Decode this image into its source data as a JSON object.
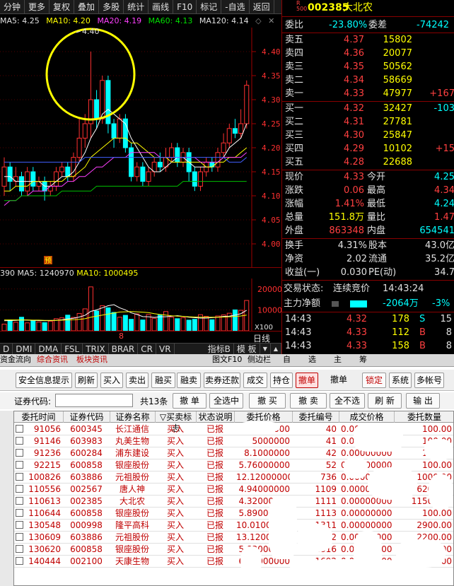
{
  "toolbar": {
    "items": [
      "分钟",
      "更多",
      "复权",
      "叠加",
      "多股",
      "统计",
      "画线",
      "F10",
      "标记",
      "-自选",
      "返回"
    ]
  },
  "ma_line": {
    "ma5": "MA5: 4.25",
    "ma10": "MA10: 4.20",
    "ma20": "MA20: 4.19",
    "ma60": "MA60: 4.13",
    "ma120": "MA120: 4.14"
  },
  "chart_data": [
    {
      "type": "candlestick",
      "ylim": [
        3.95,
        4.45
      ],
      "yticks": [
        "4.40",
        "4.35",
        "4.30",
        "4.25",
        "4.20",
        "4.15",
        "4.10",
        "4.05",
        "4.00"
      ],
      "annotation": "4.40",
      "marker": "预",
      "candles": [
        {
          "o": 4.12,
          "c": 4.16,
          "h": 4.18,
          "l": 4.1
        },
        {
          "o": 4.16,
          "c": 4.13,
          "h": 4.17,
          "l": 4.11
        },
        {
          "o": 4.13,
          "c": 4.14,
          "h": 4.16,
          "l": 4.12
        },
        {
          "o": 4.14,
          "c": 4.11,
          "h": 4.15,
          "l": 4.1
        },
        {
          "o": 4.11,
          "c": 4.15,
          "h": 4.16,
          "l": 4.1
        },
        {
          "o": 4.15,
          "c": 4.12,
          "h": 4.16,
          "l": 4.11
        },
        {
          "o": 4.12,
          "c": 4.13,
          "h": 4.14,
          "l": 4.11
        },
        {
          "o": 4.13,
          "c": 4.11,
          "h": 4.14,
          "l": 4.09
        },
        {
          "o": 4.11,
          "c": 4.12,
          "h": 4.13,
          "l": 4.1
        },
        {
          "o": 4.12,
          "c": 4.15,
          "h": 4.16,
          "l": 4.11
        },
        {
          "o": 4.15,
          "c": 4.16,
          "h": 4.17,
          "l": 4.14
        },
        {
          "o": 4.16,
          "c": 4.14,
          "h": 4.17,
          "l": 4.13
        },
        {
          "o": 4.14,
          "c": 4.18,
          "h": 4.19,
          "l": 4.13
        },
        {
          "o": 4.18,
          "c": 4.22,
          "h": 4.26,
          "l": 4.17
        },
        {
          "o": 4.22,
          "c": 4.25,
          "h": 4.27,
          "l": 4.2
        },
        {
          "o": 4.25,
          "c": 4.3,
          "h": 4.4,
          "l": 4.22
        },
        {
          "o": 4.3,
          "c": 4.26,
          "h": 4.32,
          "l": 4.24
        },
        {
          "o": 4.26,
          "c": 4.34,
          "h": 4.35,
          "l": 4.25
        },
        {
          "o": 4.34,
          "c": 4.25,
          "h": 4.35,
          "l": 4.23
        },
        {
          "o": 4.25,
          "c": 4.22,
          "h": 4.26,
          "l": 4.2
        },
        {
          "o": 4.22,
          "c": 4.26,
          "h": 4.27,
          "l": 4.21
        },
        {
          "o": 4.26,
          "c": 4.2,
          "h": 4.27,
          "l": 4.19
        },
        {
          "o": 4.2,
          "c": 4.14,
          "h": 4.21,
          "l": 4.13
        },
        {
          "o": 4.14,
          "c": 4.16,
          "h": 4.17,
          "l": 4.13
        },
        {
          "o": 4.16,
          "c": 4.13,
          "h": 4.17,
          "l": 4.12
        },
        {
          "o": 4.13,
          "c": 4.15,
          "h": 4.16,
          "l": 4.12
        },
        {
          "o": 4.15,
          "c": 4.17,
          "h": 4.18,
          "l": 4.14
        },
        {
          "o": 4.17,
          "c": 4.16,
          "h": 4.19,
          "l": 4.15
        },
        {
          "o": 4.16,
          "c": 4.18,
          "h": 4.2,
          "l": 4.15
        },
        {
          "o": 4.18,
          "c": 4.2,
          "h": 4.21,
          "l": 4.17
        },
        {
          "o": 4.2,
          "c": 4.17,
          "h": 4.21,
          "l": 4.16
        },
        {
          "o": 4.17,
          "c": 4.19,
          "h": 4.2,
          "l": 4.16
        },
        {
          "o": 4.19,
          "c": 4.15,
          "h": 4.2,
          "l": 4.13
        },
        {
          "o": 4.15,
          "c": 4.12,
          "h": 4.16,
          "l": 4.11
        },
        {
          "o": 4.12,
          "c": 4.15,
          "h": 4.16,
          "l": 4.11
        },
        {
          "o": 4.15,
          "c": 4.17,
          "h": 4.18,
          "l": 4.14
        },
        {
          "o": 4.17,
          "c": 4.16,
          "h": 4.18,
          "l": 4.15
        },
        {
          "o": 4.16,
          "c": 4.19,
          "h": 4.2,
          "l": 4.15
        },
        {
          "o": 4.19,
          "c": 4.21,
          "h": 4.23,
          "l": 4.18
        },
        {
          "o": 4.21,
          "c": 4.24,
          "h": 4.25,
          "l": 4.2
        },
        {
          "o": 4.24,
          "c": 4.23,
          "h": 4.26,
          "l": 4.22
        },
        {
          "o": 4.23,
          "c": 4.25,
          "h": 4.28,
          "l": 4.22
        },
        {
          "o": 4.25,
          "c": 4.33,
          "h": 4.34,
          "l": 4.24
        }
      ],
      "series": [
        {
          "values": [
            4.14,
            4.14,
            4.13,
            4.13,
            4.13,
            4.13,
            4.13,
            4.12,
            4.12,
            4.13,
            4.14,
            4.14,
            4.15,
            4.17,
            4.19,
            4.22,
            4.24,
            4.27,
            4.28,
            4.27,
            4.26,
            4.25,
            4.22,
            4.2,
            4.18,
            4.16,
            4.15,
            4.15,
            4.16,
            4.17,
            4.18,
            4.18,
            4.17,
            4.16,
            4.16,
            4.16,
            4.16,
            4.17,
            4.18,
            4.2,
            4.21,
            4.22,
            4.25
          ]
        },
        {
          "values": [
            4.11,
            4.11,
            4.12,
            4.12,
            4.12,
            4.13,
            4.13,
            4.13,
            4.13,
            4.13,
            4.13,
            4.14,
            4.14,
            4.15,
            4.16,
            4.18,
            4.19,
            4.2,
            4.21,
            4.22,
            4.22,
            4.22,
            4.21,
            4.21,
            4.2,
            4.19,
            4.18,
            4.18,
            4.18,
            4.17,
            4.17,
            4.17,
            4.17,
            4.17,
            4.17,
            4.16,
            4.16,
            4.17,
            4.17,
            4.18,
            4.18,
            4.19,
            4.2
          ]
        },
        {
          "values": [
            4.08,
            4.09,
            4.09,
            4.1,
            4.1,
            4.11,
            4.11,
            4.11,
            4.12,
            4.12,
            4.12,
            4.13,
            4.13,
            4.14,
            4.14,
            4.15,
            4.16,
            4.16,
            4.17,
            4.18,
            4.18,
            4.18,
            4.19,
            4.19,
            4.19,
            4.19,
            4.19,
            4.18,
            4.18,
            4.18,
            4.18,
            4.18,
            4.18,
            4.18,
            4.17,
            4.17,
            4.17,
            4.17,
            4.18,
            4.18,
            4.18,
            4.18,
            4.19
          ]
        },
        {
          "values": [
            4.09,
            4.09,
            4.09,
            4.1,
            4.1,
            4.1,
            4.1,
            4.1,
            4.1,
            4.1,
            4.11,
            4.11,
            4.11,
            4.11,
            4.11,
            4.11,
            4.12,
            4.12,
            4.12,
            4.12,
            4.12,
            4.12,
            4.12,
            4.12,
            4.12,
            4.12,
            4.12,
            4.12,
            4.12,
            4.12,
            4.12,
            4.13,
            4.13,
            4.13,
            4.13,
            4.13,
            4.13,
            4.13,
            4.13,
            4.13,
            4.13,
            4.13,
            4.13
          ]
        },
        {
          "values": [
            4.17,
            4.17,
            4.17,
            4.17,
            4.17,
            4.17,
            4.17,
            4.17,
            4.17,
            4.17,
            4.17,
            4.17,
            4.17,
            4.17,
            4.18,
            4.18,
            4.18,
            4.18,
            4.18,
            4.18,
            4.18,
            4.18,
            4.18,
            4.18,
            4.18,
            4.18,
            4.18,
            4.18,
            4.18,
            4.18,
            4.18,
            4.18,
            4.18,
            4.18,
            4.18,
            4.18,
            4.18,
            4.18,
            4.18,
            4.17,
            4.17,
            4.17,
            4.18
          ]
        }
      ]
    },
    {
      "type": "bar",
      "ylim": [
        0,
        25000
      ],
      "yticks": [
        "20000",
        "10000"
      ],
      "unit": "X100",
      "values": [
        3200,
        5200,
        4100,
        6500,
        3800,
        5000,
        4200,
        3900,
        4600,
        5800,
        6200,
        7500,
        6400,
        8300,
        10500,
        21000,
        9500,
        12000,
        11000,
        8800,
        6500,
        7400,
        5500,
        8100,
        5200,
        7800,
        6000,
        7500,
        9200,
        6500,
        5800,
        6300,
        5100,
        5500,
        7700,
        6900,
        5300,
        7100,
        7600,
        8400,
        10000,
        9800,
        14500
      ],
      "ma1": [
        4800,
        4900,
        5000,
        5200,
        5100,
        5000,
        4900,
        4800,
        4900,
        5000,
        5300,
        5700,
        6000,
        6600,
        7400,
        9300,
        10000,
        11000,
        12000,
        12500,
        11000,
        10000,
        8600,
        7800,
        6800,
        6700,
        6400,
        6700,
        6700,
        7000,
        7200,
        6900,
        6500,
        6300,
        6100,
        6100,
        6300,
        6500,
        6900,
        7000,
        7500,
        8200,
        9800
      ],
      "ma2": [
        5200,
        5200,
        5200,
        5200,
        5200,
        5100,
        5100,
        5000,
        5000,
        5000,
        5100,
        5200,
        5300,
        5500,
        5800,
        6500,
        7000,
        7500,
        8000,
        8500,
        9000,
        9100,
        9200,
        9100,
        8900,
        8700,
        8200,
        7800,
        7500,
        7200,
        7000,
        6900,
        6700,
        6600,
        6500,
        6500,
        6500,
        6500,
        6600,
        6700,
        6900,
        7100,
        7500
      ]
    }
  ],
  "vol_line": {
    "prefix": "390",
    "ma5": "MA5: 1240970",
    "ma10": "MA10: 1000495"
  },
  "date_label": "日线",
  "marker_label": "预",
  "circle_label": "4.40",
  "x_marker": "8",
  "indicator_tabs": [
    "D",
    "DMI",
    "DMA",
    "FSL",
    "TRIX",
    "BRAR",
    "CR",
    "VR"
  ],
  "indicator_buttons": [
    "指标B",
    "模 板"
  ],
  "quote": {
    "code_prefix": "R\n500",
    "code": "002385",
    "name": "大北农",
    "weibi_label": "委比",
    "weibi": "-23.80%",
    "weicha_label": "委差",
    "weicha": "-74242",
    "asks": [
      {
        "label": "卖五",
        "price": "4.37",
        "vol": "15802",
        "chg": ""
      },
      {
        "label": "卖四",
        "price": "4.36",
        "vol": "20077",
        "chg": ""
      },
      {
        "label": "卖三",
        "price": "4.35",
        "vol": "50562",
        "chg": ""
      },
      {
        "label": "卖二",
        "price": "4.34",
        "vol": "58669",
        "chg": ""
      },
      {
        "label": "卖一",
        "price": "4.33",
        "vol": "47977",
        "chg": "+167"
      }
    ],
    "bids": [
      {
        "label": "买一",
        "price": "4.32",
        "vol": "32427",
        "chg": "-103"
      },
      {
        "label": "买二",
        "price": "4.31",
        "vol": "27781",
        "chg": ""
      },
      {
        "label": "买三",
        "price": "4.30",
        "vol": "25847",
        "chg": ""
      },
      {
        "label": "买四",
        "price": "4.29",
        "vol": "10102",
        "chg": "+15"
      },
      {
        "label": "买五",
        "price": "4.28",
        "vol": "22688",
        "chg": ""
      }
    ],
    "stats": [
      {
        "l1": "现价",
        "v1": "4.33",
        "l2": "今开",
        "v2": "4.25",
        "c1": "red",
        "c2": "cyan"
      },
      {
        "l1": "涨跌",
        "v1": "0.06",
        "l2": "最高",
        "v2": "4.34",
        "c1": "red",
        "c2": "red"
      },
      {
        "l1": "涨幅",
        "v1": "1.41%",
        "l2": "最低",
        "v2": "4.24",
        "c1": "red",
        "c2": "cyan"
      },
      {
        "l1": "总量",
        "v1": "151.8万",
        "l2": "量比",
        "v2": "1.47",
        "c1": "yel",
        "c2": "red"
      },
      {
        "l1": "外盘",
        "v1": "863348",
        "l2": "内盘",
        "v2": "654541",
        "c1": "red",
        "c2": "cyan"
      }
    ],
    "stats2": [
      {
        "l1": "换手",
        "v1": "4.31%",
        "l2": "股本",
        "v2": "43.0亿"
      },
      {
        "l1": "净资",
        "v1": "2.02",
        "l2": "流通",
        "v2": "35.2亿"
      },
      {
        "l1": "收益(一)",
        "v1": "0.030",
        "l2": "PE(动)",
        "v2": "34.7"
      }
    ],
    "trade_status_label": "交易状态:",
    "trade_status": "连续竞价",
    "trade_time": "14:43:24",
    "main_net_label": "主力净额",
    "main_net": "-2064万",
    "main_net_pct": "-3%",
    "ticks": [
      {
        "t": "14:43",
        "p": "4.32",
        "v": "178",
        "s": "S",
        "n": "15"
      },
      {
        "t": "14:43",
        "p": "4.33",
        "v": "112",
        "s": "B",
        "n": "8"
      },
      {
        "t": "14:43",
        "p": "4.33",
        "v": "158",
        "s": "B",
        "n": "8"
      }
    ]
  },
  "bottom_tabs": {
    "left": [
      "资金流向",
      "综合资讯",
      "板块资讯"
    ],
    "right": [
      "图文F10",
      "侧边栏",
      "自",
      "选",
      "主",
      "筹"
    ]
  },
  "trade": {
    "buttons": [
      "安全信息提示",
      "刷新",
      "买入",
      "卖出",
      "融买",
      "融卖",
      "卖券还款",
      "成交",
      "持仓",
      "撤单",
      "撤单",
      "锁定",
      "系统",
      "多帐号"
    ],
    "code_label": "证券代码:",
    "code_value": "",
    "count_label": "共13条",
    "filter_buttons": [
      "撤 单",
      "全选中",
      "撤 买",
      "撤 卖",
      "全不选",
      "刷 新",
      "输 出"
    ],
    "columns": [
      "委托时间",
      "证券代码",
      "证券名称",
      "▽买卖标志",
      "状态说明",
      "委托价格",
      "委托编号",
      "成交价格",
      "委托数量"
    ],
    "rows": [
      {
        "time": "91056",
        "code": "600345",
        "name": "长江通信",
        "side": "买入",
        "status": "已报",
        "price": "0.0000000",
        "no": "40",
        "deal": "0.00000000",
        "qty": "100.00"
      },
      {
        "time": "91146",
        "code": "603983",
        "name": "丸美生物",
        "side": "买入",
        "status": "已报",
        "price": "5000000",
        "no": "41",
        "deal": "0.00000000",
        "qty": "100.00"
      },
      {
        "time": "91236",
        "code": "600284",
        "name": "浦东建设",
        "side": "买入",
        "status": "已报",
        "price": "8.1000000",
        "no": "42",
        "deal": "0.00000000",
        "qty": "100.00"
      },
      {
        "time": "92215",
        "code": "600858",
        "name": "银座股份",
        "side": "买入",
        "status": "已报",
        "price": "5.76000000",
        "no": "52",
        "deal": "0.00000000",
        "qty": "100.00"
      },
      {
        "time": "100826",
        "code": "603886",
        "name": "元祖股份",
        "side": "买入",
        "status": "已报",
        "price": "12.12000000",
        "no": "736",
        "deal": "0.00000000",
        "qty": "1000.00"
      },
      {
        "time": "110556",
        "code": "002567",
        "name": "唐人神",
        "side": "买入",
        "status": "已报",
        "price": "4.94000000",
        "no": "1109",
        "deal": "0.00000000",
        "qty": "6200.00"
      },
      {
        "time": "110613",
        "code": "002385",
        "name": "大北农",
        "side": "买入",
        "status": "已报",
        "price": "4.32000000",
        "no": "1111",
        "deal": "0.00000000",
        "qty": "11500.00"
      },
      {
        "time": "110644",
        "code": "600858",
        "name": "银座股份",
        "side": "买入",
        "status": "已报",
        "price": "5.89000000",
        "no": "1113",
        "deal": "0.00000000",
        "qty": "100.00"
      },
      {
        "time": "130548",
        "code": "000998",
        "name": "隆平高科",
        "side": "买入",
        "status": "已报",
        "price": "10.01000000",
        "no": "1311",
        "deal": "0.00000000",
        "qty": "2900.00"
      },
      {
        "time": "130609",
        "code": "603886",
        "name": "元祖股份",
        "side": "买入",
        "status": "已报",
        "price": "13.12000000",
        "no": "1312",
        "deal": "0.00000000",
        "qty": "2200.00"
      },
      {
        "time": "130620",
        "code": "600858",
        "name": "银座股份",
        "side": "买入",
        "status": "已报",
        "price": "5.83000000",
        "no": "1316",
        "deal": "0.00000000",
        "qty": "5100.00"
      },
      {
        "time": "140444",
        "code": "002100",
        "name": "天康生物",
        "side": "买入",
        "status": "已报",
        "price": "6.78000000",
        "no": "1692",
        "deal": "0.00000000",
        "qty": "100.00"
      }
    ]
  }
}
